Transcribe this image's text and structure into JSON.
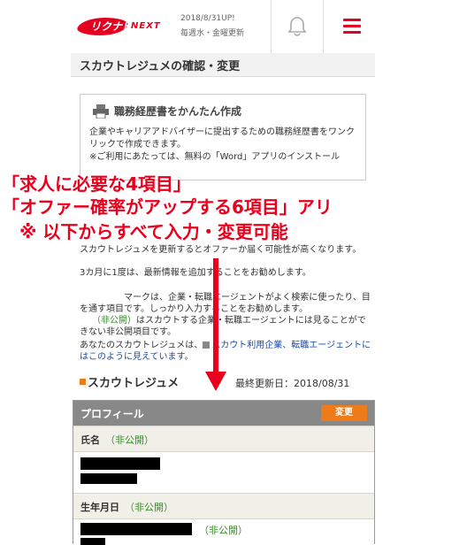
{
  "header": {
    "logo_text": "リクナビ",
    "logo_next": "NEXT",
    "update_date": "2018/8/31UP!",
    "update_schedule": "毎週水・金曜更新"
  },
  "page": {
    "title": "スカウトレジュメの確認・変更"
  },
  "resume_box": {
    "title": "職務経歴書をかんたん作成",
    "desc": "企業やキャリアアドバイザーに提出するための職務経歴書をワンクリックで作成できます。",
    "note": "※ご利用にあたっては、無料の「Word」アプリのインストール"
  },
  "info": {
    "line1": "スカウトレジュメを更新するとオファーか届く可能性が高くなります。",
    "line2": "3カ月に1度は、最新情報を追加することをお勧めします。",
    "line3": "マークは、企業・転職エージェントがよく検索に使ったり、目を通す項目です。しっかり入力することをお勧めします。",
    "line4_pvt": "（非公開）",
    "line4_rest": "はスカウトする企業・転職エージェントには見ることができない非公開項目です。",
    "line5_pre": "あなたのスカウトレジュメは、",
    "line5_link": "スカウト利用企業、転職エージェントにはこのように見えています。"
  },
  "section": {
    "title": "スカウトレジュメ",
    "updated": "最終更新日：2018/08/31"
  },
  "profile": {
    "head": "プロフィール",
    "edit": "変更",
    "name_label": "氏名",
    "name_private": "（非公開）",
    "birth_label": "生年月日",
    "birth_private": "（非公開）",
    "birth_value_private": "（非公開）"
  },
  "annotation": {
    "line1": "「求人に必要な4項目」",
    "line2": "「オファー確率がアップする6項目」アリ",
    "line3": "※ 以下からすべて入力・変更可能"
  },
  "colors": {
    "brand_red": "#e6001f",
    "annotation_red": "#e8001c",
    "edit_orange": "#ee7a1a",
    "private_green": "#3a8a2a"
  },
  "icons": [
    "bell-icon",
    "hamburger-menu-icon",
    "printer-icon",
    "section-marker-icon",
    "down-arrow-icon"
  ]
}
